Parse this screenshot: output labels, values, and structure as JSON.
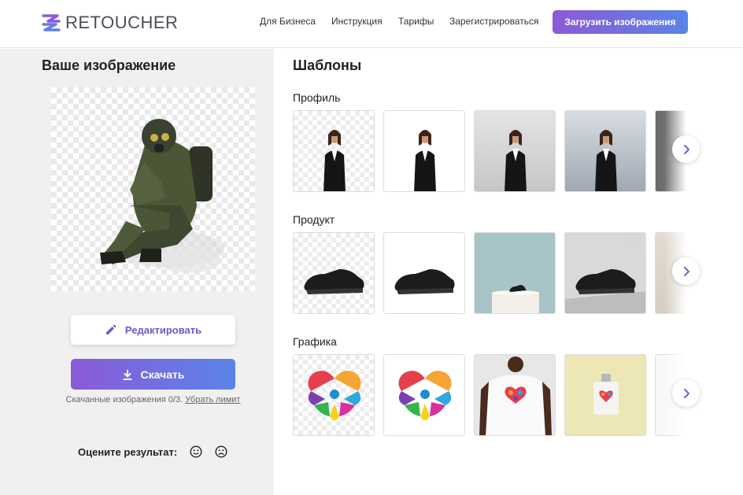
{
  "header": {
    "logo_text": "RETOUCHER",
    "nav": [
      "Для Бизнеса",
      "Инструкция",
      "Тарифы",
      "Зарегистрироваться"
    ],
    "upload_label": "Загрузить изображения"
  },
  "left": {
    "title": "Ваше изображение",
    "edit_label": "Редактировать",
    "download_label": "Скачать",
    "download_note": "Скачанные изображения 0/3.",
    "limit_link": "Убрать лимит",
    "rate_label": "Оцените результат:"
  },
  "templates": {
    "title": "Шаблоны",
    "rows": [
      {
        "title": "Профиль",
        "backgrounds": [
          "checker",
          "white",
          "light-gray",
          "blue-gray",
          "dark-gray"
        ]
      },
      {
        "title": "Продукт",
        "backgrounds": [
          "checker",
          "white",
          "teal-podium",
          "gray-wall",
          "marble"
        ]
      },
      {
        "title": "Графика",
        "backgrounds": [
          "checker",
          "white",
          "t-shirt",
          "perfume-bottle",
          "bottle"
        ]
      }
    ]
  },
  "colors": {
    "accent_start": "#8b5ad8",
    "accent_end": "#5a84e8",
    "edit_text": "#6a5acd"
  }
}
